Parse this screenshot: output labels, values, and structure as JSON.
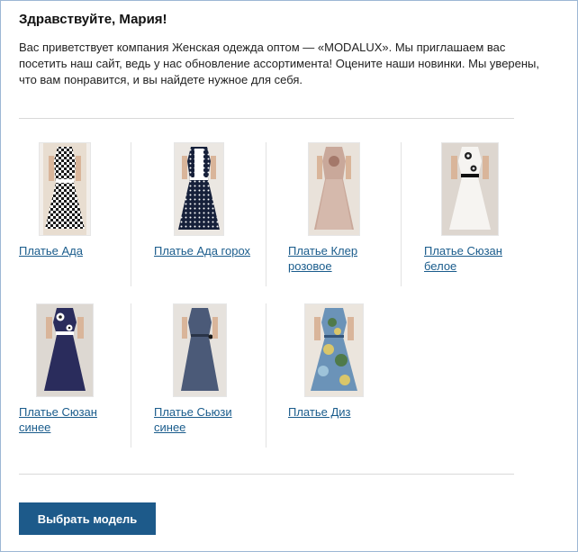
{
  "greeting": "Здравствуйте, Мария!",
  "intro": "Вас приветствует компания Женская одежда оптом — «MODALUX». Мы приглашаем вас посетить наш сайт, ведь у нас обновление ассортимента! Оцените наши новинки. Мы уверены, что вам понравится, и вы найдете нужное для себя.",
  "products": [
    {
      "label": "Платье Ада"
    },
    {
      "label": "Платье Ада горох"
    },
    {
      "label": "Платье Клер розовое"
    },
    {
      "label": "Платье Сюзан белое"
    },
    {
      "label": "Платье Сюзан синее"
    },
    {
      "label": "Платье Сьюзи синее"
    },
    {
      "label": "Платье Диз"
    }
  ],
  "cta_label": "Выбрать модель",
  "colors": {
    "link": "#1a5c8c",
    "button": "#1d5a8a",
    "frame_border": "#9db7d4"
  }
}
